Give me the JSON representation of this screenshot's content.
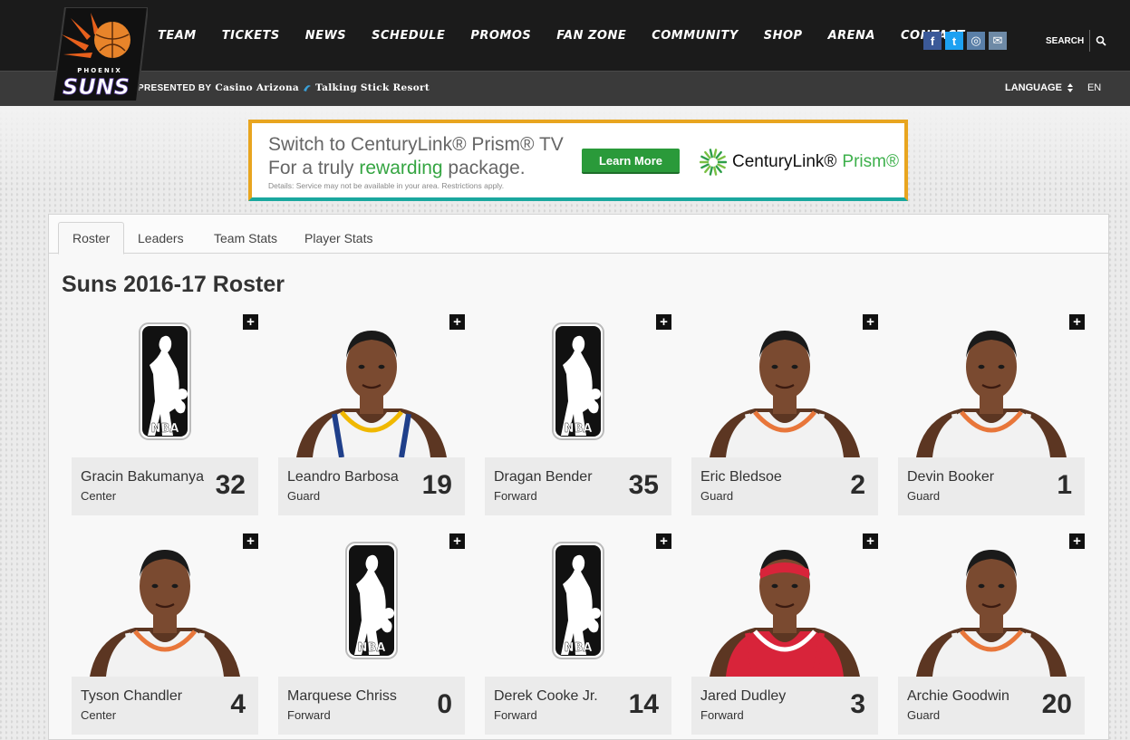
{
  "header": {
    "logo_text": "SUNS",
    "logo_subtext": "PHOENIX",
    "nav": [
      "TEAM",
      "TICKETS",
      "NEWS",
      "SCHEDULE",
      "PROMOS",
      "FAN ZONE",
      "COMMUNITY",
      "SHOP",
      "ARENA",
      "CONTACT"
    ],
    "social": [
      {
        "icon": "facebook-icon",
        "glyph": "f",
        "color": "#3b5998"
      },
      {
        "icon": "twitter-icon",
        "glyph": "t",
        "color": "#1da1f2"
      },
      {
        "icon": "instagram-icon",
        "glyph": "◎",
        "color": "#5a7fa8"
      },
      {
        "icon": "mail-icon",
        "glyph": "✉",
        "color": "#6e8aa6"
      }
    ],
    "search_label": "SEARCH",
    "presented_by": "PRESENTED BY",
    "sponsor_1": "Casino Arizona",
    "sponsor_2": "Talking Stick Resort",
    "language_label": "LANGUAGE",
    "language_code": "EN"
  },
  "ad": {
    "line1": "Switch to CenturyLink® Prism® TV",
    "line2_pre": "For a truly ",
    "line2_highlight": "rewarding",
    "line2_post": " package.",
    "fine_print": "Details: Service may not be available in your area. Restrictions apply.",
    "button": "Learn More",
    "brand": "CenturyLink®",
    "brand_product": "Prism®",
    "accent_color": "#35a542"
  },
  "tabs": [
    "Roster",
    "Leaders",
    "Team Stats",
    "Player Stats"
  ],
  "active_tab": "Roster",
  "roster_title": "Suns 2016-17 Roster",
  "players": [
    {
      "name": "Gracin Bakumanya",
      "position": "Center",
      "number": "32",
      "photo": "nba-logo",
      "jersey": "none"
    },
    {
      "name": "Leandro Barbosa",
      "position": "Guard",
      "number": "19",
      "photo": "player",
      "jersey": "warriors"
    },
    {
      "name": "Dragan Bender",
      "position": "Forward",
      "number": "35",
      "photo": "nba-logo",
      "jersey": "none"
    },
    {
      "name": "Eric Bledsoe",
      "position": "Guard",
      "number": "2",
      "photo": "player",
      "jersey": "suns"
    },
    {
      "name": "Devin Booker",
      "position": "Guard",
      "number": "1",
      "photo": "player",
      "jersey": "suns"
    },
    {
      "name": "Tyson Chandler",
      "position": "Center",
      "number": "4",
      "photo": "player",
      "jersey": "suns"
    },
    {
      "name": "Marquese Chriss",
      "position": "Forward",
      "number": "0",
      "photo": "nba-logo",
      "jersey": "none"
    },
    {
      "name": "Derek Cooke Jr.",
      "position": "Forward",
      "number": "14",
      "photo": "nba-logo",
      "jersey": "none"
    },
    {
      "name": "Jared Dudley",
      "position": "Forward",
      "number": "3",
      "photo": "player",
      "jersey": "wizards"
    },
    {
      "name": "Archie Goodwin",
      "position": "Guard",
      "number": "20",
      "photo": "player",
      "jersey": "suns"
    }
  ],
  "expand_glyph": "+"
}
